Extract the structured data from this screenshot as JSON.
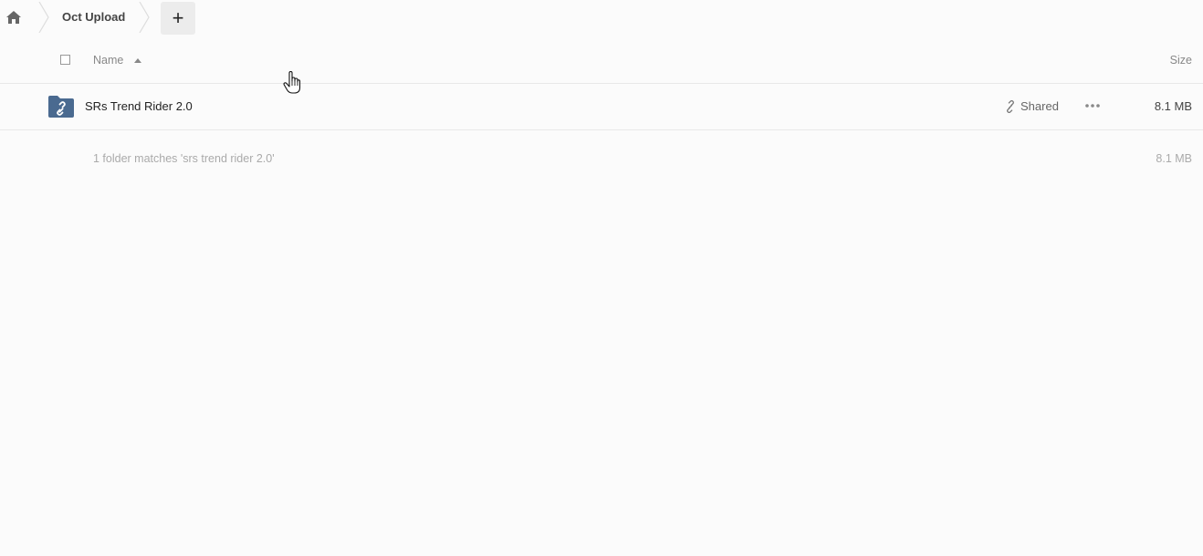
{
  "breadcrumb": {
    "home_icon": "home-icon",
    "folder_label": "Oct Upload",
    "add_label": "+"
  },
  "table": {
    "header": {
      "name_label": "Name",
      "size_label": "Size",
      "sort_direction": "ascending"
    },
    "rows": [
      {
        "name": "SRs Trend Rider 2.0",
        "type_icon": "shared-folder-icon",
        "share_label": "Shared",
        "size": "8.1 MB"
      }
    ],
    "summary": {
      "text": "1 folder matches 'srs trend rider 2.0'",
      "size": "8.1 MB"
    }
  },
  "colors": {
    "background": "#fbfbfb",
    "folder": "#4a6a90",
    "muted_text": "#aaaaaa",
    "button_bg": "#ececec"
  }
}
